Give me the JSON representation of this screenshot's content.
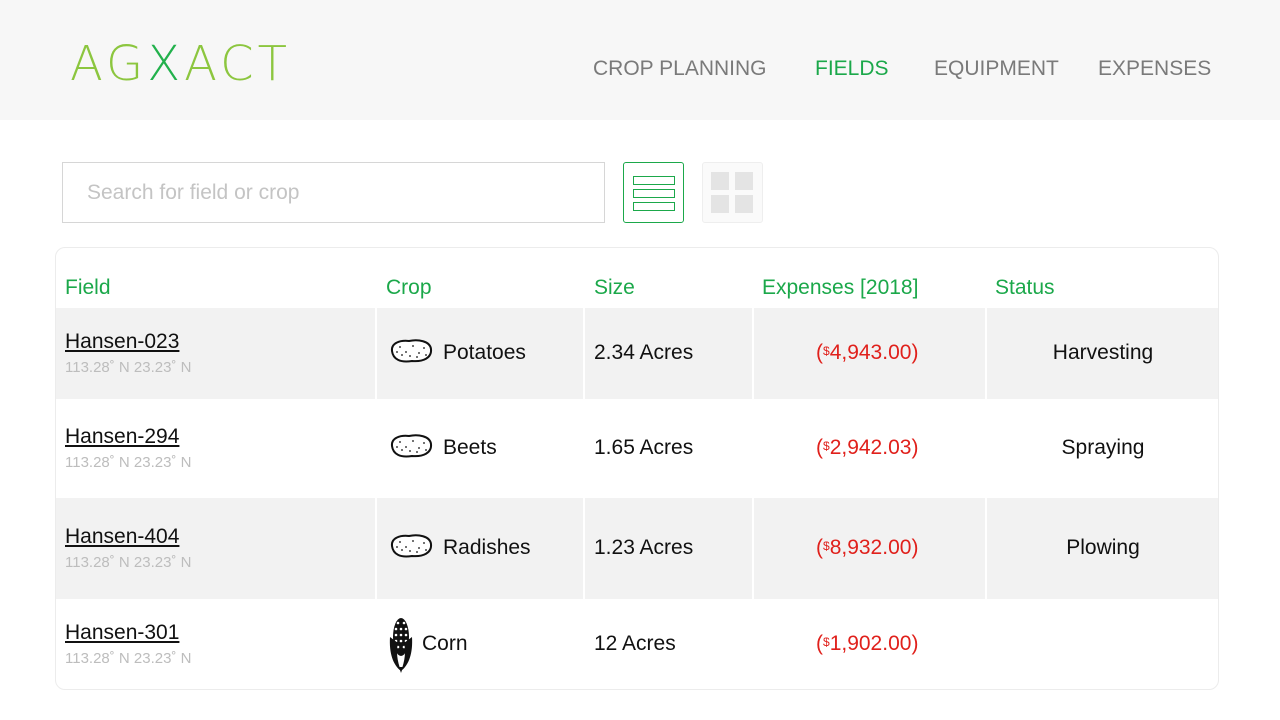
{
  "header": {
    "logo_prefix": "AG",
    "logo_x": "X",
    "logo_suffix": "ACT",
    "nav": [
      {
        "label": "CROP PLANNING"
      },
      {
        "label": "FIELDS"
      },
      {
        "label": "EQUIPMENT"
      },
      {
        "label": "EXPENSES"
      }
    ],
    "active_nav": "FIELDS"
  },
  "toolbar": {
    "search_placeholder": "Search for field or crop",
    "view_mode": "list",
    "list_view_icon": "list-view-icon",
    "grid_view_icon": "grid-view-icon"
  },
  "table": {
    "columns": [
      "Field",
      "Crop",
      "Size",
      "Expenses [2018]",
      "Status"
    ],
    "rows": [
      {
        "field": "Hansen-023",
        "coords": "113.28˚ N 23.23˚ N",
        "crop": "Potatoes",
        "crop_icon": "potato-icon",
        "size": "2.34 Acres",
        "currency": "$",
        "expense": "4,943.00",
        "status": "Harvesting"
      },
      {
        "field": "Hansen-294",
        "coords": "113.28˚ N 23.23˚ N",
        "crop": "Beets",
        "crop_icon": "potato-icon",
        "size": "1.65 Acres",
        "currency": "$",
        "expense": "2,942.03",
        "status": "Spraying"
      },
      {
        "field": "Hansen-404",
        "coords": "113.28˚ N 23.23˚ N",
        "crop": "Radishes",
        "crop_icon": "potato-icon",
        "size": "1.23 Acres",
        "currency": "$",
        "expense": "8,932.00",
        "status": "Plowing"
      },
      {
        "field": "Hansen-301",
        "coords": "113.28˚ N 23.23˚ N",
        "crop": "Corn",
        "crop_icon": "corn-icon",
        "size": "12 Acres",
        "currency": "$",
        "expense": "1,902.00",
        "status": ""
      }
    ]
  },
  "colors": {
    "brand_green": "#1ba84a",
    "logo_green": "#8cc63f",
    "expense_red": "#e0201b"
  }
}
